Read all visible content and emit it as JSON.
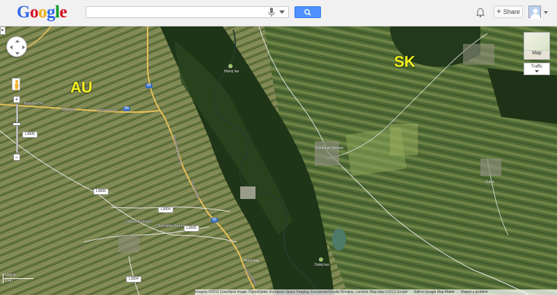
{
  "header": {
    "logo_letters": [
      {
        "ch": "G",
        "color": "#3369e8"
      },
      {
        "ch": "o",
        "color": "#d50f25"
      },
      {
        "ch": "o",
        "color": "#eeb211"
      },
      {
        "ch": "g",
        "color": "#3369e8"
      },
      {
        "ch": "l",
        "color": "#009925"
      },
      {
        "ch": "e",
        "color": "#d50f25"
      }
    ],
    "search_value": "",
    "share_label": "Share",
    "share_plus": "+"
  },
  "map": {
    "sidetab": "▸",
    "zoom_plus": "+",
    "zoom_minus": "−",
    "map_type_label": "Map",
    "traffic_label": "Traffic",
    "country_labels": [
      "AU",
      "SK"
    ],
    "road_labels": {
      "angerner_str_1": "Angerner Str.",
      "strassbog": "Straßbog",
      "angerner_str_2": "Angerner Str.",
      "bernhardsthaler_str": "Bernhardsthaler Str.",
      "obersiebenbrunn": "Obersiebenbrunn",
      "obersiebenbrunn2": "Obersiebenbrunn",
      "ungarstrasse": "Ungarstraße",
      "hauptstrasse": "Hauptstraße"
    },
    "shields": [
      "49",
      "8A",
      "49"
    ],
    "road_pills": [
      "L3005",
      "L3005",
      "L3004",
      "L3005",
      "L3004"
    ],
    "place_labels": {
      "town1": "Vysoká pri Morave",
      "town2": "Zohor",
      "forest1": "Horný les",
      "forest2": "Dolný les",
      "marchegg": "Marchegg"
    },
    "scale": {
      "top": "5000 ft",
      "bottom": "1 km"
    },
    "footer": {
      "attribution": "Imagery ©2013 Cnes/Spot Image, DigitalGlobe, European Space Imaging, Eurosense/Geodis Slovakia, Landsat, Map data ©2013 Google",
      "edit_link": "Edit in Google Map Maker",
      "report_link": "Report a problem"
    }
  }
}
